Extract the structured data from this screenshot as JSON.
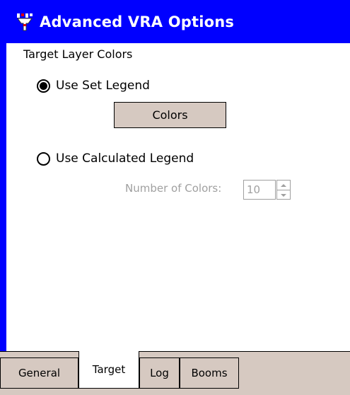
{
  "window": {
    "title": "Advanced VRA Options",
    "app_icon": "app-logo-icon"
  },
  "section": {
    "label": "Target Layer Colors"
  },
  "options": {
    "set_legend": {
      "label": "Use Set Legend",
      "checked": true
    },
    "calculated_legend": {
      "label": "Use Calculated Legend",
      "checked": false
    }
  },
  "colors_button": {
    "label": "Colors"
  },
  "number_of_colors": {
    "label": "Number of Colors:",
    "value": "10",
    "enabled": false
  },
  "tabs": [
    {
      "label": "General",
      "active": false
    },
    {
      "label": "Target",
      "active": true
    },
    {
      "label": "Log",
      "active": false
    },
    {
      "label": "Booms",
      "active": false
    }
  ],
  "colors": {
    "titlebar": "#0000ff",
    "button_face": "#d6c9c1",
    "disabled_text": "#a0a0a0"
  }
}
